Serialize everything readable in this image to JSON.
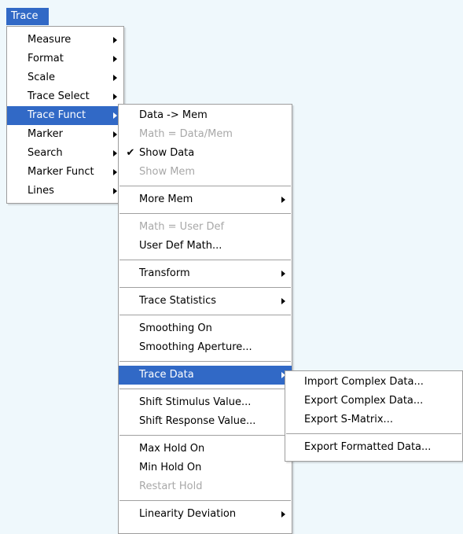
{
  "menubar": {
    "trace_label": "Trace"
  },
  "main_menu": {
    "items": [
      {
        "label": "Measure"
      },
      {
        "label": "Format"
      },
      {
        "label": "Scale"
      },
      {
        "label": "Trace Select"
      },
      {
        "label": "Trace Funct"
      },
      {
        "label": "Marker"
      },
      {
        "label": "Search"
      },
      {
        "label": "Marker Funct"
      },
      {
        "label": "Lines"
      }
    ]
  },
  "trace_funct_menu": {
    "data_to_mem": "Data -> Mem",
    "math_data_mem": "Math = Data/Mem",
    "show_data": "Show Data",
    "show_data_check": "✔",
    "show_mem": "Show Mem",
    "more_mem": "More Mem",
    "math_user_def": "Math = User Def",
    "user_def_math": "User Def Math...",
    "transform": "Transform",
    "trace_statistics": "Trace Statistics",
    "smoothing_on": "Smoothing On",
    "smoothing_aperture": "Smoothing Aperture...",
    "trace_data": "Trace Data",
    "shift_stimulus": "Shift Stimulus Value...",
    "shift_response": "Shift Response Value...",
    "max_hold_on": "Max Hold On",
    "min_hold_on": "Min Hold On",
    "restart_hold": "Restart Hold",
    "linearity_deviation": "Linearity Deviation"
  },
  "trace_data_menu": {
    "import_complex": "Import Complex Data...",
    "export_complex": "Export Complex Data...",
    "export_smatrix": "Export S-Matrix...",
    "export_formatted": "Export Formatted Data..."
  },
  "colors": {
    "highlight": "#3169c6",
    "background": "#eff8fc",
    "disabled_text": "#a8a8a8"
  }
}
